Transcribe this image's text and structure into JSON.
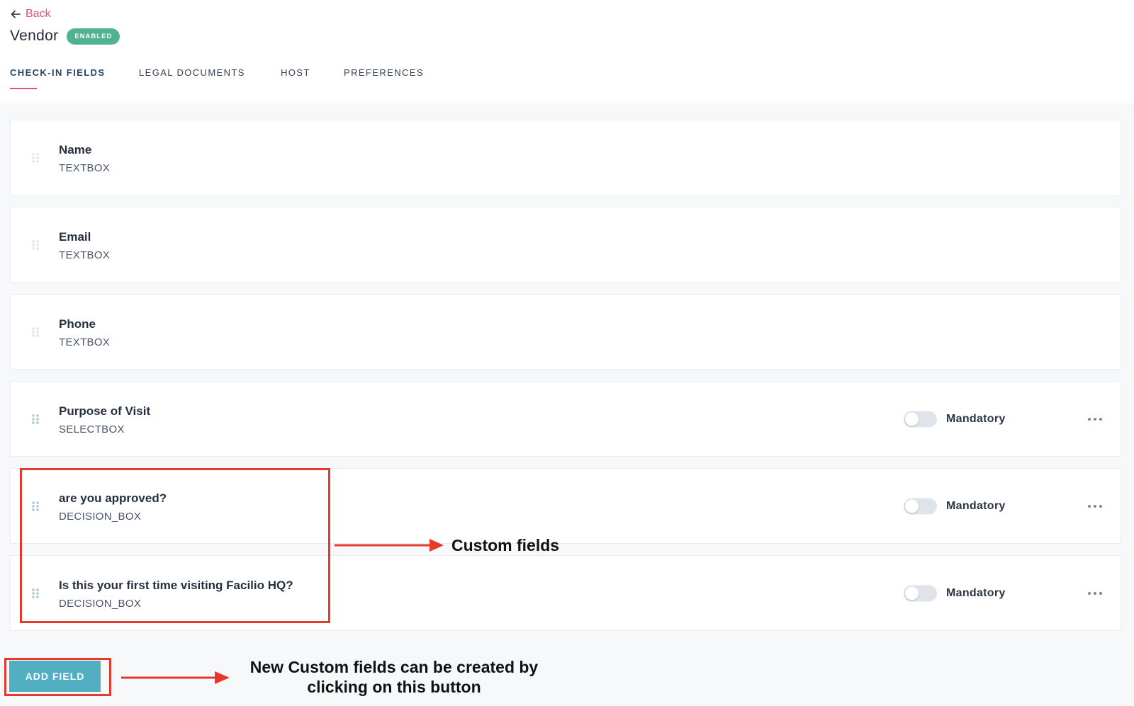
{
  "back_label": "Back",
  "title": "Vendor",
  "status_badge": "ENABLED",
  "tabs": [
    {
      "label": "CHECK-IN FIELDS",
      "active": true
    },
    {
      "label": "LEGAL DOCUMENTS",
      "active": false
    },
    {
      "label": "HOST",
      "active": false
    },
    {
      "label": "PREFERENCES",
      "active": false
    }
  ],
  "fields": [
    {
      "name": "Name",
      "type": "TEXTBOX"
    },
    {
      "name": "Email",
      "type": "TEXTBOX"
    },
    {
      "name": "Phone",
      "type": "TEXTBOX"
    },
    {
      "name": "Purpose of Visit",
      "type": "SELECTBOX",
      "mandatory_label": "Mandatory",
      "mandatory": false
    },
    {
      "name": "are you approved?",
      "type": "DECISION_BOX",
      "mandatory_label": "Mandatory",
      "mandatory": false
    },
    {
      "name": "Is this your first time visiting Facilio HQ?",
      "type": "DECISION_BOX",
      "mandatory_label": "Mandatory",
      "mandatory": false
    }
  ],
  "add_field_label": "ADD FIELD",
  "annotations": {
    "custom_fields": "Custom fields",
    "add_field_line1": "New Custom fields can be created by",
    "add_field_line2": "clicking on this button"
  },
  "colors": {
    "accent_pink": "#e2507b",
    "badge_green": "#4fb391",
    "button_teal": "#52afc2",
    "annotation_red": "#e43a2b"
  }
}
